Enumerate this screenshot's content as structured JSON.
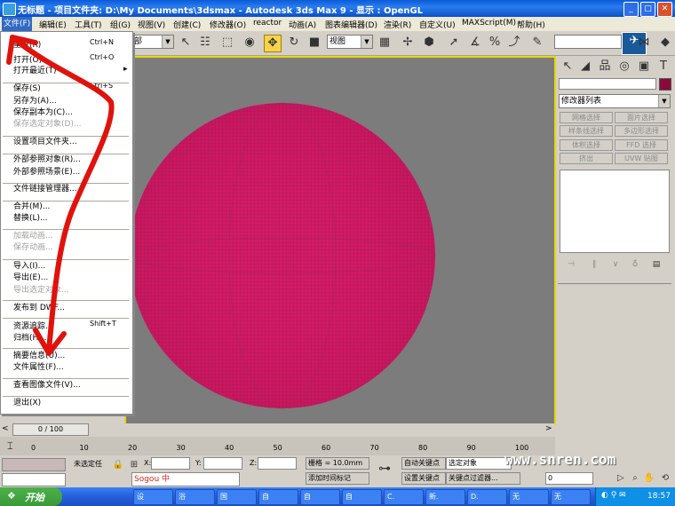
{
  "window": {
    "title": "无标题   - 项目文件夹: D:\\My Documents\\3dsmax    - Autodesk 3ds Max 9      - 显示 : OpenGL"
  },
  "menubar": [
    "文件(F)",
    "编辑(E)",
    "工具(T)",
    "组(G)",
    "视图(V)",
    "创建(C)",
    "修改器(O)",
    "reactor",
    "动画(A)",
    "图表编辑器(D)",
    "渲染(R)",
    "自定义(U)",
    "MAXScript(M)",
    "帮助(H)"
  ],
  "toolbar": {
    "selection_filter": "部",
    "view_dropdown": "视图"
  },
  "file_menu": {
    "items": [
      {
        "label": "重置(R)",
        "shortcut": "Ctrl+N",
        "disabled": false
      },
      {
        "label": "打开(O)...",
        "shortcut": "Ctrl+O",
        "disabled": false
      },
      {
        "label": "打开最近(T)",
        "shortcut": "",
        "disabled": false
      },
      {
        "label": "保存(S)",
        "shortcut": "Ctrl+S",
        "disabled": false
      },
      {
        "label": "另存为(A)...",
        "shortcut": "",
        "disabled": false
      },
      {
        "label": "保存副本为(C)...",
        "shortcut": "",
        "disabled": false
      },
      {
        "label": "保存选定对象(D)...",
        "shortcut": "",
        "disabled": true
      },
      {
        "label": "设置项目文件夹...",
        "shortcut": "",
        "disabled": false
      },
      {
        "label": "外部参照对象(R)...",
        "shortcut": "",
        "disabled": false
      },
      {
        "label": "外部参照场景(E)...",
        "shortcut": "",
        "disabled": false
      },
      {
        "label": "文件链接管理器...",
        "shortcut": "",
        "disabled": false
      },
      {
        "label": "合并(M)...",
        "shortcut": "",
        "disabled": false
      },
      {
        "label": "替换(L)...",
        "shortcut": "",
        "disabled": false
      },
      {
        "label": "加载动画...",
        "shortcut": "",
        "disabled": true
      },
      {
        "label": "保存动画...",
        "shortcut": "",
        "disabled": true
      },
      {
        "label": "导入(I)...",
        "shortcut": "",
        "disabled": false
      },
      {
        "label": "导出(E)...",
        "shortcut": "",
        "disabled": false
      },
      {
        "label": "导出选定对象...",
        "shortcut": "",
        "disabled": true
      },
      {
        "label": "发布到 DWF...",
        "shortcut": "",
        "disabled": false
      },
      {
        "label": "资源追踪...",
        "shortcut": "Shift+T",
        "disabled": false
      },
      {
        "label": "归档(H)...",
        "shortcut": "",
        "disabled": false
      },
      {
        "label": "摘要信息(U)...",
        "shortcut": "",
        "disabled": false
      },
      {
        "label": "文件属性(F)...",
        "shortcut": "",
        "disabled": false
      },
      {
        "label": "查看图像文件(V)...",
        "shortcut": "",
        "disabled": false
      },
      {
        "label": "退出(X)",
        "shortcut": "",
        "disabled": false
      }
    ]
  },
  "command_panel": {
    "modifier_list": "修改器列表",
    "buttons": [
      "网格选择",
      "面片选择",
      "样条线选择",
      "多边形选择",
      "体积选择",
      "FFD 选择",
      "挤出",
      "UVW 贴图"
    ]
  },
  "timeline": {
    "frame_label": "0 / 100",
    "ticks": [
      "0",
      "10",
      "20",
      "30",
      "40",
      "50",
      "60",
      "70",
      "80",
      "90",
      "100"
    ]
  },
  "status": {
    "selection": "未选定任",
    "x_label": "X:",
    "y_label": "Y:",
    "z_label": "Z:",
    "grid": "栅格 = 10.0mm",
    "add_time_tag": "添加时间标记",
    "auto_key": "自动关键点",
    "set_key": "设置关键点",
    "selected_object": "选定对象",
    "key_filter": "关键点过滤器...",
    "frame_value": "0"
  },
  "taskbar": {
    "start": "开始",
    "tasks": [
      "设",
      "浴",
      "国",
      "自",
      "自",
      "自",
      "C.",
      "新.",
      "D.",
      "无",
      "无"
    ],
    "clock": "18:57",
    "ime": "Sogou 中"
  },
  "watermark": "www.snren.com",
  "colors": {
    "sphere_wire": "#e0186b",
    "viewport_bg": "#7c7c7c",
    "annotation_arrow": "#e0120c"
  }
}
